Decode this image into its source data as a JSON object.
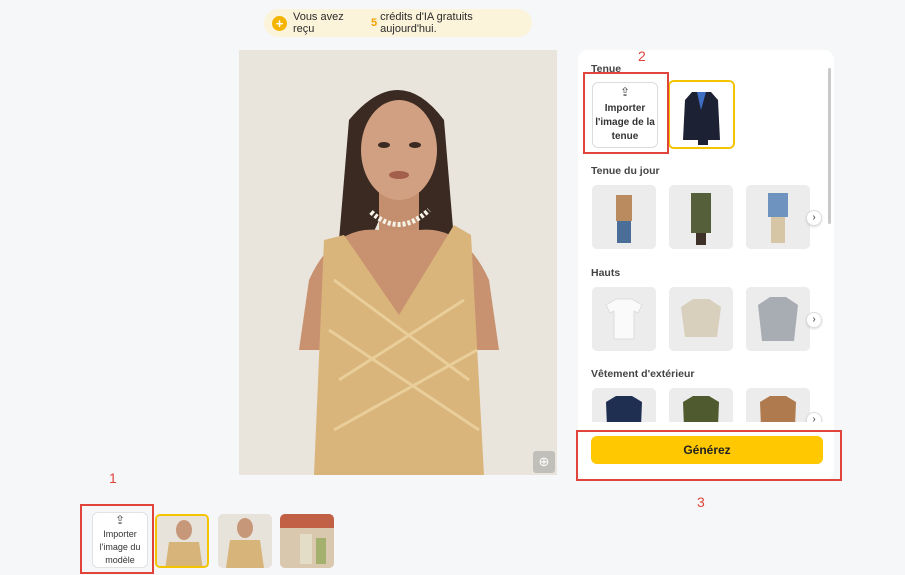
{
  "banner": {
    "prefix": "Vous avez reçu",
    "count": "5",
    "suffix": "crédits d'IA gratuits aujourd'hui."
  },
  "panel": {
    "sections": [
      {
        "title": "Tenue"
      },
      {
        "title": "Tenue du jour"
      },
      {
        "title": "Hauts"
      },
      {
        "title": "Vêtement d'extérieur"
      }
    ],
    "upload_outfit_label": "Importer l'image de la tenue",
    "generate_label": "Générez"
  },
  "bottom": {
    "upload_model_label": "Importer l'image du modèle"
  },
  "annotations": [
    "1",
    "2",
    "3"
  ],
  "colors": {
    "accent": "#ffc800",
    "annotation": "#e0443b",
    "banner_bg": "#fbf3da"
  },
  "icons": {
    "upload": "upload-icon",
    "zoom": "zoom-in-icon",
    "arrow": "chevron-right-icon",
    "plus": "plus-circle-icon"
  }
}
